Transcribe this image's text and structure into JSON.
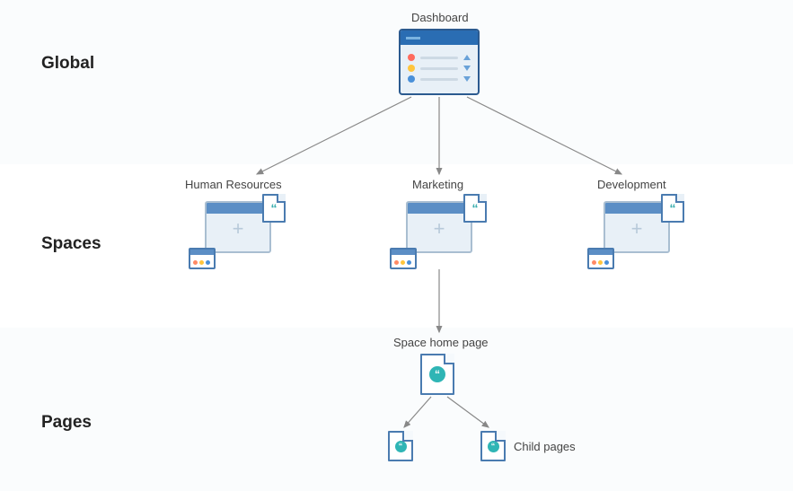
{
  "tiers": {
    "global_label": "Global",
    "spaces_label": "Spaces",
    "pages_label": "Pages"
  },
  "dashboard": {
    "label": "Dashboard"
  },
  "spaces": {
    "hr_label": "Human Resources",
    "marketing_label": "Marketing",
    "development_label": "Development"
  },
  "pages": {
    "home_label": "Space home page",
    "child_label": "Child pages"
  }
}
